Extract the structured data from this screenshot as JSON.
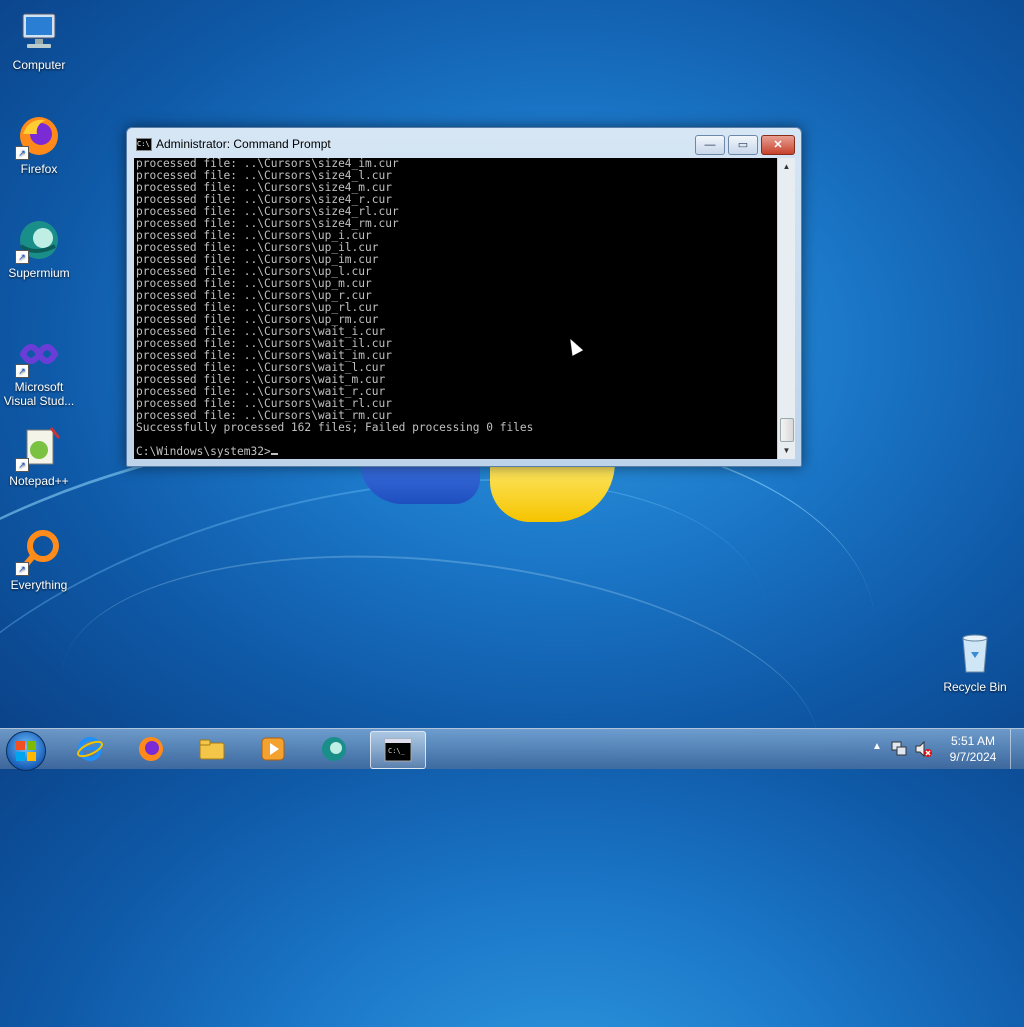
{
  "desktop": {
    "icons": [
      {
        "label": "Computer"
      },
      {
        "label": "Firefox"
      },
      {
        "label": "Supermium"
      },
      {
        "label": "Microsoft Visual Stud..."
      },
      {
        "label": "Notepad++"
      },
      {
        "label": "Everything"
      },
      {
        "label": "Recycle Bin"
      }
    ]
  },
  "window": {
    "title": "Administrator: Command Prompt",
    "icon_text": "C:\\",
    "buttons": {
      "minimize": "—",
      "maximize": "▭",
      "close": "✕"
    },
    "console_lines": [
      "processed file: ..\\Cursors\\size4_im.cur",
      "processed file: ..\\Cursors\\size4_l.cur",
      "processed file: ..\\Cursors\\size4_m.cur",
      "processed file: ..\\Cursors\\size4_r.cur",
      "processed file: ..\\Cursors\\size4_rl.cur",
      "processed file: ..\\Cursors\\size4_rm.cur",
      "processed file: ..\\Cursors\\up_i.cur",
      "processed file: ..\\Cursors\\up_il.cur",
      "processed file: ..\\Cursors\\up_im.cur",
      "processed file: ..\\Cursors\\up_l.cur",
      "processed file: ..\\Cursors\\up_m.cur",
      "processed file: ..\\Cursors\\up_r.cur",
      "processed file: ..\\Cursors\\up_rl.cur",
      "processed file: ..\\Cursors\\up_rm.cur",
      "processed file: ..\\Cursors\\wait_i.cur",
      "processed file: ..\\Cursors\\wait_il.cur",
      "processed file: ..\\Cursors\\wait_im.cur",
      "processed file: ..\\Cursors\\wait_l.cur",
      "processed file: ..\\Cursors\\wait_m.cur",
      "processed file: ..\\Cursors\\wait_r.cur",
      "processed file: ..\\Cursors\\wait_rl.cur",
      "processed file: ..\\Cursors\\wait_rm.cur",
      "Successfully processed 162 files; Failed processing 0 files"
    ],
    "prompt": "C:\\Windows\\system32>"
  },
  "taskbar": {
    "items": [
      {
        "name": "internet-explorer-icon"
      },
      {
        "name": "firefox-icon"
      },
      {
        "name": "file-explorer-icon"
      },
      {
        "name": "media-player-icon"
      },
      {
        "name": "supermium-icon"
      },
      {
        "name": "command-prompt-icon",
        "active": true
      }
    ],
    "tray": {
      "time": "5:51 AM",
      "date": "9/7/2024"
    }
  }
}
